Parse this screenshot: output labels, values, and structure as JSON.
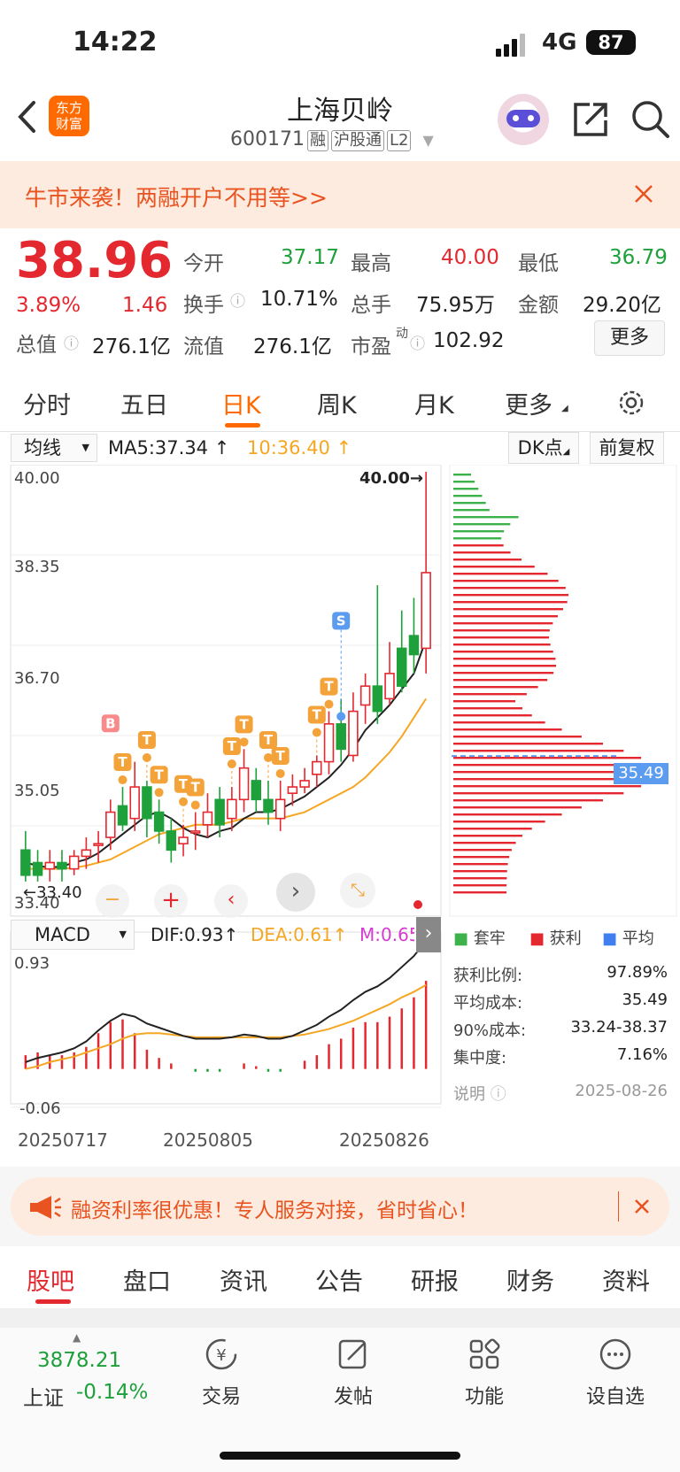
{
  "status": {
    "time": "14:22",
    "network": "4G",
    "battery": "87"
  },
  "header": {
    "logo": "东方\n财富",
    "name": "上海贝岭",
    "code": "600171",
    "tags": [
      "融",
      "沪股通",
      "L2"
    ]
  },
  "banner": {
    "text": "牛市来袭！两融开户不用等>>"
  },
  "quote": {
    "price": "38.96",
    "pct": "3.89%",
    "chg": "1.46",
    "open_label": "今开",
    "open": "37.17",
    "high_label": "最高",
    "high": "40.00",
    "low_label": "最低",
    "low": "36.79",
    "turnover_label": "换手",
    "turnover": "10.71%",
    "volume_label": "总手",
    "volume": "75.95万",
    "amount_label": "金额",
    "amount": "29.20亿",
    "mcap_label": "总值",
    "mcap": "276.1亿",
    "float_label": "流值",
    "float": "276.1亿",
    "pe_label": "市盈",
    "pe_sup": "动",
    "pe": "102.92",
    "more": "更多"
  },
  "tabs": [
    "分时",
    "五日",
    "日K",
    "周K",
    "月K",
    "更多"
  ],
  "active_tab": "日K",
  "indicator": {
    "ma_select": "均线",
    "ma5": "MA5:37.34",
    "ma10": "10:36.40",
    "dk": "DK点",
    "adjust": "前复权"
  },
  "kline": {
    "price_labels": [
      "40.00",
      "38.35",
      "36.70",
      "35.05",
      "33.40"
    ],
    "max_label": "40.00→",
    "min_label": "←33.40"
  },
  "macd": {
    "select": "MACD",
    "dif": "DIF:0.93",
    "dea": "DEA:0.61",
    "m": "M:0.65",
    "top": "0.93",
    "bottom": "-0.06"
  },
  "dates": [
    "20250717",
    "20250805",
    "20250826"
  ],
  "chip": {
    "legend": [
      "套牢",
      "获利",
      "平均"
    ],
    "avg_tag": "35.49",
    "rows": [
      {
        "k": "获利比例:",
        "v": "97.89%"
      },
      {
        "k": "平均成本:",
        "v": "35.49"
      },
      {
        "k": "90%成本:",
        "v": "33.24-38.37"
      },
      {
        "k": "集中度:",
        "v": "7.16%"
      }
    ],
    "note": "说明",
    "date": "2025-08-26"
  },
  "ad": {
    "text": "融资利率很优惠！专人服务对接，省时省心！"
  },
  "sections": [
    "股吧",
    "盘口",
    "资讯",
    "公告",
    "研报",
    "财务",
    "资料"
  ],
  "bottom": {
    "index_value": "3878.21",
    "index_name": "上证",
    "index_pct": "-0.14%",
    "items": [
      "交易",
      "发帖",
      "功能",
      "设自选"
    ]
  },
  "colors": {
    "up": "#e3282f",
    "down": "#1ea03a",
    "accent": "#ff6a00"
  },
  "chart_data": {
    "type": "candlestick",
    "ylim": [
      33.4,
      40.0
    ],
    "candles": [
      [
        34.0,
        33.6,
        34.3,
        33.5
      ],
      [
        33.8,
        33.6,
        34.0,
        33.5
      ],
      [
        33.7,
        33.8,
        34.0,
        33.5
      ],
      [
        33.8,
        33.7,
        34.0,
        33.5
      ],
      [
        33.7,
        33.9,
        34.0,
        33.6
      ],
      [
        33.9,
        34.0,
        34.2,
        33.7
      ],
      [
        34.1,
        34.1,
        34.3,
        33.8
      ],
      [
        34.2,
        34.6,
        34.8,
        34.0
      ],
      [
        34.7,
        34.4,
        35.0,
        34.3
      ],
      [
        34.5,
        35.0,
        35.4,
        34.3
      ],
      [
        35.0,
        34.5,
        35.1,
        34.2
      ],
      [
        34.6,
        34.3,
        34.8,
        34.1
      ],
      [
        34.3,
        34.0,
        34.5,
        33.8
      ],
      [
        34.1,
        34.2,
        34.4,
        33.9
      ],
      [
        34.3,
        34.3,
        34.6,
        34.0
      ],
      [
        34.4,
        34.6,
        34.9,
        34.2
      ],
      [
        34.8,
        34.4,
        35.0,
        34.2
      ],
      [
        34.5,
        34.8,
        35.0,
        34.3
      ],
      [
        34.8,
        35.3,
        35.6,
        34.6
      ],
      [
        35.1,
        34.8,
        35.3,
        34.6
      ],
      [
        34.8,
        34.6,
        35.1,
        34.4
      ],
      [
        34.5,
        34.8,
        35.1,
        34.3
      ],
      [
        34.9,
        35.0,
        35.2,
        34.7
      ],
      [
        35.0,
        35.1,
        35.3,
        34.9
      ],
      [
        35.2,
        35.4,
        35.5,
        35.0
      ],
      [
        35.4,
        36.0,
        36.2,
        35.2
      ],
      [
        36.0,
        35.6,
        36.4,
        35.4
      ],
      [
        35.5,
        36.2,
        36.5,
        35.4
      ],
      [
        36.3,
        36.6,
        36.8,
        36.0
      ],
      [
        36.6,
        36.2,
        38.2,
        36.0
      ],
      [
        36.4,
        36.8,
        37.3,
        36.3
      ],
      [
        37.2,
        36.6,
        37.8,
        36.5
      ],
      [
        37.4,
        37.1,
        38.0,
        36.8
      ],
      [
        37.2,
        38.4,
        40.0,
        36.8
      ]
    ],
    "ma5": [
      33.8,
      33.75,
      33.72,
      33.74,
      33.8,
      33.85,
      33.95,
      34.1,
      34.25,
      34.4,
      34.55,
      34.6,
      34.5,
      34.35,
      34.25,
      34.2,
      34.3,
      34.35,
      34.5,
      34.6,
      34.6,
      34.65,
      34.75,
      34.85,
      35.0,
      35.15,
      35.35,
      35.6,
      35.9,
      36.1,
      36.3,
      36.55,
      36.8,
      37.34
    ],
    "ma10": [
      33.7,
      33.7,
      33.7,
      33.7,
      33.72,
      33.75,
      33.8,
      33.85,
      33.95,
      34.05,
      34.15,
      34.25,
      34.3,
      34.35,
      34.4,
      34.4,
      34.4,
      34.45,
      34.5,
      34.5,
      34.5,
      34.5,
      34.55,
      34.6,
      34.7,
      34.8,
      34.9,
      35.0,
      35.15,
      35.35,
      35.55,
      35.8,
      36.1,
      36.4
    ],
    "dif": [
      0.05,
      0.08,
      0.1,
      0.12,
      0.15,
      0.2,
      0.28,
      0.35,
      0.4,
      0.38,
      0.33,
      0.3,
      0.27,
      0.24,
      0.22,
      0.22,
      0.22,
      0.23,
      0.25,
      0.24,
      0.22,
      0.22,
      0.24,
      0.28,
      0.32,
      0.38,
      0.43,
      0.5,
      0.56,
      0.6,
      0.66,
      0.74,
      0.82,
      0.93
    ],
    "dea": [
      0.0,
      0.02,
      0.05,
      0.07,
      0.09,
      0.12,
      0.15,
      0.18,
      0.22,
      0.25,
      0.26,
      0.26,
      0.25,
      0.24,
      0.23,
      0.23,
      0.23,
      0.23,
      0.23,
      0.23,
      0.23,
      0.23,
      0.24,
      0.25,
      0.27,
      0.29,
      0.32,
      0.35,
      0.39,
      0.43,
      0.47,
      0.52,
      0.56,
      0.61
    ],
    "macd_hist": [
      0.1,
      0.12,
      0.1,
      0.1,
      0.12,
      0.16,
      0.26,
      0.34,
      0.36,
      0.26,
      0.14,
      0.08,
      0.04,
      0.0,
      -0.02,
      -0.02,
      -0.02,
      0.0,
      0.04,
      0.02,
      -0.02,
      -0.02,
      0.0,
      0.06,
      0.1,
      0.18,
      0.22,
      0.3,
      0.34,
      0.34,
      0.38,
      0.44,
      0.52,
      0.64
    ]
  }
}
